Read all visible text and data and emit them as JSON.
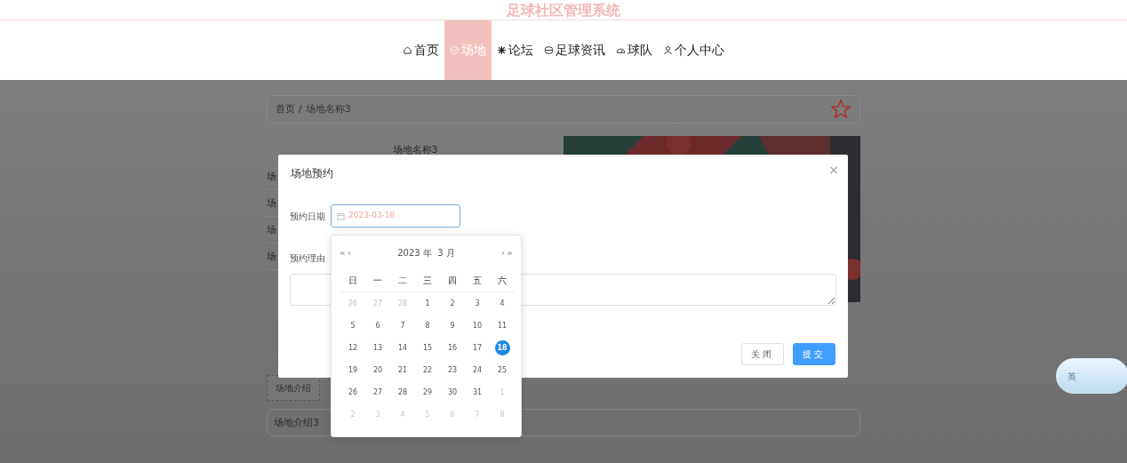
{
  "header": {
    "title": "足球社区管理系统"
  },
  "nav": [
    {
      "label": "首页",
      "selected": false
    },
    {
      "label": "场地",
      "selected": true
    },
    {
      "label": "论坛",
      "selected": false
    },
    {
      "label": "足球资讯",
      "selected": false
    },
    {
      "label": "球队",
      "selected": false
    },
    {
      "label": "个人中心",
      "selected": false
    }
  ],
  "breadcrumb": {
    "items": [
      "首页",
      "场地名称3"
    ],
    "separator": "/",
    "favorited": false
  },
  "detail": {
    "title": "场地名称3",
    "row_labels": [
      "场",
      "场",
      "场",
      "场"
    ]
  },
  "tabs": [
    {
      "label": "场地介绍",
      "selected": true
    }
  ],
  "intro": "场地介绍3",
  "modal": {
    "title": "场地预约",
    "close": "×",
    "fields": [
      {
        "kind": "date",
        "label": "预约日期",
        "value": "2023-03-18",
        "focused": true
      },
      {
        "kind": "textarea",
        "label": "预约理由"
      }
    ],
    "buttons": [
      {
        "kind": "secondary",
        "label": "关闭"
      },
      {
        "kind": "primary",
        "label": "提交"
      }
    ]
  },
  "calendar": {
    "prev_year": "«",
    "prev_month": "‹",
    "title": "2023 年  3 月",
    "next_month": "›",
    "next_year": "»",
    "weekdays": [
      "日",
      "一",
      "二",
      "三",
      "四",
      "五",
      "六"
    ],
    "weeks": [
      [
        {
          "day": "26",
          "other_month": true,
          "selected": false
        },
        {
          "day": "27",
          "other_month": true,
          "selected": false
        },
        {
          "day": "28",
          "other_month": true,
          "selected": false
        },
        {
          "day": "1",
          "other_month": false,
          "selected": false
        },
        {
          "day": "2",
          "other_month": false,
          "selected": false
        },
        {
          "day": "3",
          "other_month": false,
          "selected": false
        },
        {
          "day": "4",
          "other_month": false,
          "selected": false
        }
      ],
      [
        {
          "day": "5",
          "other_month": false,
          "selected": false
        },
        {
          "day": "6",
          "other_month": false,
          "selected": false
        },
        {
          "day": "7",
          "other_month": false,
          "selected": false
        },
        {
          "day": "8",
          "other_month": false,
          "selected": false
        },
        {
          "day": "9",
          "other_month": false,
          "selected": false
        },
        {
          "day": "10",
          "other_month": false,
          "selected": false
        },
        {
          "day": "11",
          "other_month": false,
          "selected": false
        }
      ],
      [
        {
          "day": "12",
          "other_month": false,
          "selected": false
        },
        {
          "day": "13",
          "other_month": false,
          "selected": false
        },
        {
          "day": "14",
          "other_month": false,
          "selected": false
        },
        {
          "day": "15",
          "other_month": false,
          "selected": false
        },
        {
          "day": "16",
          "other_month": false,
          "selected": false
        },
        {
          "day": "17",
          "other_month": false,
          "selected": false
        },
        {
          "day": "18",
          "other_month": false,
          "selected": true
        }
      ],
      [
        {
          "day": "19",
          "other_month": false,
          "selected": false
        },
        {
          "day": "20",
          "other_month": false,
          "selected": false
        },
        {
          "day": "21",
          "other_month": false,
          "selected": false
        },
        {
          "day": "22",
          "other_month": false,
          "selected": false
        },
        {
          "day": "23",
          "other_month": false,
          "selected": false
        },
        {
          "day": "24",
          "other_month": false,
          "selected": false
        },
        {
          "day": "25",
          "other_month": false,
          "selected": false
        }
      ],
      [
        {
          "day": "26",
          "other_month": false,
          "selected": false
        },
        {
          "day": "27",
          "other_month": false,
          "selected": false
        },
        {
          "day": "28",
          "other_month": false,
          "selected": false
        },
        {
          "day": "29",
          "other_month": false,
          "selected": false
        },
        {
          "day": "30",
          "other_month": false,
          "selected": false
        },
        {
          "day": "31",
          "other_month": false,
          "selected": false
        },
        {
          "day": "1",
          "other_month": true,
          "selected": false
        }
      ],
      [
        {
          "day": "2",
          "other_month": true,
          "selected": false
        },
        {
          "day": "3",
          "other_month": true,
          "selected": false
        },
        {
          "day": "4",
          "other_month": true,
          "selected": false
        },
        {
          "day": "5",
          "other_month": true,
          "selected": false
        },
        {
          "day": "6",
          "other_month": true,
          "selected": false
        },
        {
          "day": "7",
          "other_month": true,
          "selected": false
        },
        {
          "day": "8",
          "other_month": true,
          "selected": false
        }
      ]
    ]
  },
  "ime_widget": {
    "label": "英"
  }
}
